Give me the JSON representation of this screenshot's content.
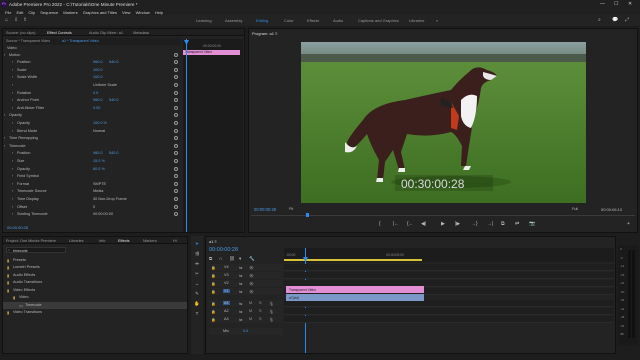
{
  "window": {
    "title": "Adobe Premiere Pro 2022 - C:\\Tutorials\\One Minute Premiere *",
    "controls": [
      "—",
      "☐",
      "✕"
    ]
  },
  "menu": [
    "File",
    "Edit",
    "Clip",
    "Sequence",
    "Markers",
    "Graphics and Titles",
    "View",
    "Window",
    "Help"
  ],
  "workspaces": {
    "items": [
      "Learning",
      "Assembly",
      "Editing",
      "Color",
      "Effects",
      "Audio",
      "Captions and Graphics",
      "Libraries"
    ],
    "active": "Editing",
    "more": "»"
  },
  "effect_panel": {
    "tabs": [
      "Source: (no clips)",
      "Effect Controls",
      "Audio Clip Mixer: a1",
      "Metadata"
    ],
    "active_tab": "Effect Controls",
    "clip_path": "Source * Transparent Video",
    "sequence_path": "a1 * Transparent Video",
    "section": "Video",
    "rows": [
      {
        "label": "Motion",
        "value": ""
      },
      {
        "label": "Position",
        "value": "960.0",
        "value2": "540.0"
      },
      {
        "label": "Scale",
        "value": "100.0"
      },
      {
        "label": "Scale Width",
        "value": "100.0"
      },
      {
        "label": "",
        "value": "Uniform Scale"
      },
      {
        "label": "Rotation",
        "value": "0.0"
      },
      {
        "label": "Anchor Point",
        "value": "960.0",
        "value2": "540.0"
      },
      {
        "label": "Anti-flicker Filter",
        "value": "0.00"
      },
      {
        "label": "Opacity",
        "value": ""
      },
      {
        "label": "Opacity",
        "value": "100.0 %"
      },
      {
        "label": "Blend Mode",
        "value": "Normal"
      },
      {
        "label": "Time Remapping",
        "value": ""
      },
      {
        "label": "Timecode",
        "value": ""
      },
      {
        "label": "Position",
        "value": "960.0",
        "value2": "540.0"
      },
      {
        "label": "Size",
        "value": "15.0 %"
      },
      {
        "label": "Opacity",
        "value": "60.0 %"
      },
      {
        "label": "Field Symbol",
        "value": ""
      },
      {
        "label": "Format",
        "value": "SMPTE"
      },
      {
        "label": "Timecode Source",
        "value": "Media"
      },
      {
        "label": "Time Display",
        "value": "30 Non-Drop Frame"
      },
      {
        "label": "Offset",
        "value": "0"
      },
      {
        "label": "Starting Timecode",
        "value": "00:00:00:00"
      }
    ],
    "timecode": "00:00:00:28",
    "mini_clip_label": "Transparent Video",
    "mini_ruler": "00:00:00:00"
  },
  "program": {
    "title": "Program: a1 ≡",
    "overlay_timecode": "00:30:00:28",
    "current_time": "00:00:00:28",
    "zoom": "Fit",
    "quality": "Full",
    "duration": "00:00:06:10",
    "controls": [
      "{",
      "|←",
      "{←",
      "◀|",
      "▶",
      "|▶",
      "→}",
      "→|",
      "⧉",
      "⇄",
      "📷",
      "+"
    ]
  },
  "project": {
    "tabs": [
      "Project: One Minute Premiere",
      "Libraries",
      "Info",
      "Effects",
      "Markers",
      "Hi"
    ],
    "active_tab": "Effects",
    "search": "timecode",
    "tree": [
      {
        "label": "Presets",
        "indent": 0
      },
      {
        "label": "Lumetri Presets",
        "indent": 0
      },
      {
        "label": "Audio Effects",
        "indent": 0
      },
      {
        "label": "Audio Transitions",
        "indent": 0
      },
      {
        "label": "Video Effects",
        "indent": 0
      },
      {
        "label": "Video",
        "indent": 1
      },
      {
        "label": "Timecode",
        "indent": 2,
        "selected": true
      },
      {
        "label": "Video Transitions",
        "indent": 0
      }
    ]
  },
  "timeline": {
    "tab": "a1 ≡",
    "timecode": "00:00:00:28",
    "ruler": [
      ":00:00",
      "00:00:05:00"
    ],
    "tracks": [
      {
        "name": "V4"
      },
      {
        "name": "V3"
      },
      {
        "name": "V2"
      },
      {
        "name": "V1"
      },
      {
        "name": "A1"
      },
      {
        "name": "A2"
      },
      {
        "name": "A3"
      }
    ],
    "master": {
      "label": "Mix",
      "value": "0.0"
    },
    "clips": [
      {
        "label": "Transparent Video",
        "color": "#e38fd6"
      },
      {
        "label": "a7(vid)",
        "color": "#7b98c9"
      }
    ],
    "playhead_color": "#2d8ceb"
  },
  "meter_labels": [
    "0",
    "-6",
    "-12",
    "-18",
    "-24",
    "-30",
    "-36",
    "-42",
    "-48",
    "-54",
    "dB"
  ]
}
